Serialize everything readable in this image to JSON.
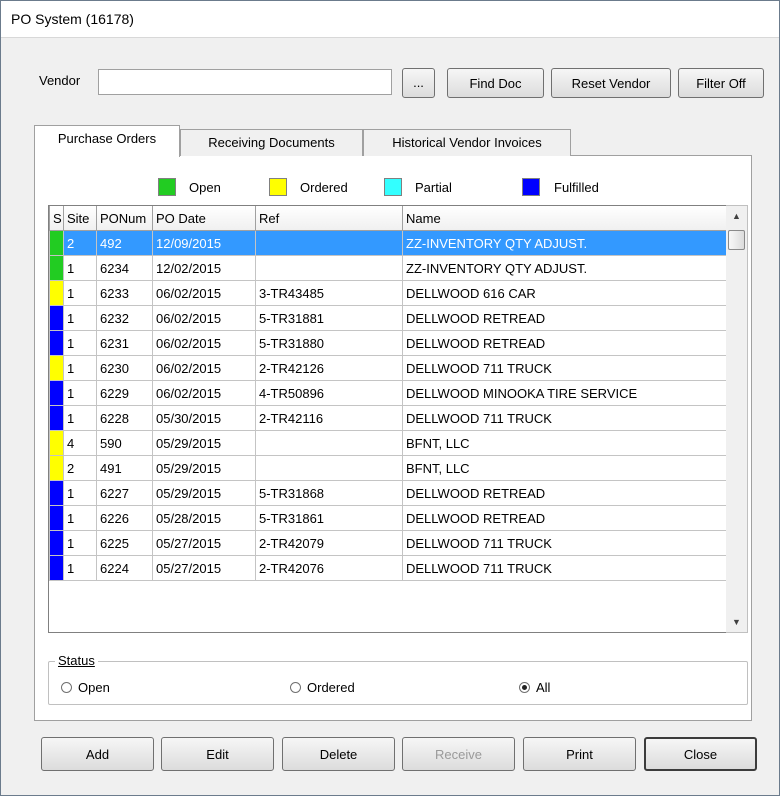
{
  "window": {
    "title": "PO System (16178)"
  },
  "vendor": {
    "label": "Vendor",
    "value": ""
  },
  "top_buttons": {
    "ellipsis": "...",
    "find_doc": "Find Doc",
    "reset_vendor": "Reset Vendor",
    "filter_off": "Filter Off"
  },
  "tabs": [
    {
      "label": "Purchase Orders",
      "active": true
    },
    {
      "label": "Receiving Documents",
      "active": false
    },
    {
      "label": "Historical Vendor Invoices",
      "active": false
    }
  ],
  "legend": [
    {
      "label": "Open",
      "color": "#22cc22"
    },
    {
      "label": "Ordered",
      "color": "#ffff00"
    },
    {
      "label": "Partial",
      "color": "#33ffff"
    },
    {
      "label": "Fulfilled",
      "color": "#0000ff"
    }
  ],
  "columns": [
    "S",
    "Site",
    "PONum",
    "PO Date",
    "Ref",
    "Name"
  ],
  "rows": [
    {
      "status": "Open",
      "color": "#22cc22",
      "site": "2",
      "ponum": "492",
      "date": "12/09/2015",
      "ref": "",
      "name": "ZZ-INVENTORY QTY ADJUST.",
      "selected": true
    },
    {
      "status": "Open",
      "color": "#22cc22",
      "site": "1",
      "ponum": "6234",
      "date": "12/02/2015",
      "ref": "",
      "name": "ZZ-INVENTORY QTY ADJUST.",
      "selected": false
    },
    {
      "status": "Ordered",
      "color": "#ffff00",
      "site": "1",
      "ponum": "6233",
      "date": "06/02/2015",
      "ref": "3-TR43485",
      "name": "DELLWOOD  616 CAR",
      "selected": false
    },
    {
      "status": "Fulfilled",
      "color": "#0000ff",
      "site": "1",
      "ponum": "6232",
      "date": "06/02/2015",
      "ref": "5-TR31881",
      "name": "DELLWOOD RETREAD",
      "selected": false
    },
    {
      "status": "Fulfilled",
      "color": "#0000ff",
      "site": "1",
      "ponum": "6231",
      "date": "06/02/2015",
      "ref": "5-TR31880",
      "name": "DELLWOOD RETREAD",
      "selected": false
    },
    {
      "status": "Ordered",
      "color": "#ffff00",
      "site": "1",
      "ponum": "6230",
      "date": "06/02/2015",
      "ref": "2-TR42126",
      "name": "DELLWOOD 711 TRUCK",
      "selected": false
    },
    {
      "status": "Fulfilled",
      "color": "#0000ff",
      "site": "1",
      "ponum": "6229",
      "date": "06/02/2015",
      "ref": "4-TR50896",
      "name": "DELLWOOD MINOOKA TIRE SERVICE",
      "selected": false
    },
    {
      "status": "Fulfilled",
      "color": "#0000ff",
      "site": "1",
      "ponum": "6228",
      "date": "05/30/2015",
      "ref": "2-TR42116",
      "name": "DELLWOOD 711 TRUCK",
      "selected": false
    },
    {
      "status": "Ordered",
      "color": "#ffff00",
      "site": "4",
      "ponum": "590",
      "date": "05/29/2015",
      "ref": "",
      "name": "BFNT, LLC",
      "selected": false
    },
    {
      "status": "Ordered",
      "color": "#ffff00",
      "site": "2",
      "ponum": "491",
      "date": "05/29/2015",
      "ref": "",
      "name": "BFNT, LLC",
      "selected": false
    },
    {
      "status": "Fulfilled",
      "color": "#0000ff",
      "site": "1",
      "ponum": "6227",
      "date": "05/29/2015",
      "ref": "5-TR31868",
      "name": "DELLWOOD RETREAD",
      "selected": false
    },
    {
      "status": "Fulfilled",
      "color": "#0000ff",
      "site": "1",
      "ponum": "6226",
      "date": "05/28/2015",
      "ref": "5-TR31861",
      "name": "DELLWOOD RETREAD",
      "selected": false
    },
    {
      "status": "Fulfilled",
      "color": "#0000ff",
      "site": "1",
      "ponum": "6225",
      "date": "05/27/2015",
      "ref": "2-TR42079",
      "name": "DELLWOOD 711 TRUCK",
      "selected": false
    },
    {
      "status": "Fulfilled",
      "color": "#0000ff",
      "site": "1",
      "ponum": "6224",
      "date": "05/27/2015",
      "ref": "2-TR42076",
      "name": "DELLWOOD 711 TRUCK",
      "selected": false
    }
  ],
  "status_group": {
    "title": "Status",
    "options": [
      {
        "label": "Open",
        "checked": false
      },
      {
        "label": "Ordered",
        "checked": false
      },
      {
        "label": "All",
        "checked": true
      }
    ]
  },
  "bottom_buttons": {
    "add": "Add",
    "edit": "Edit",
    "delete": "Delete",
    "receive": "Receive",
    "print": "Print",
    "close": "Close"
  }
}
